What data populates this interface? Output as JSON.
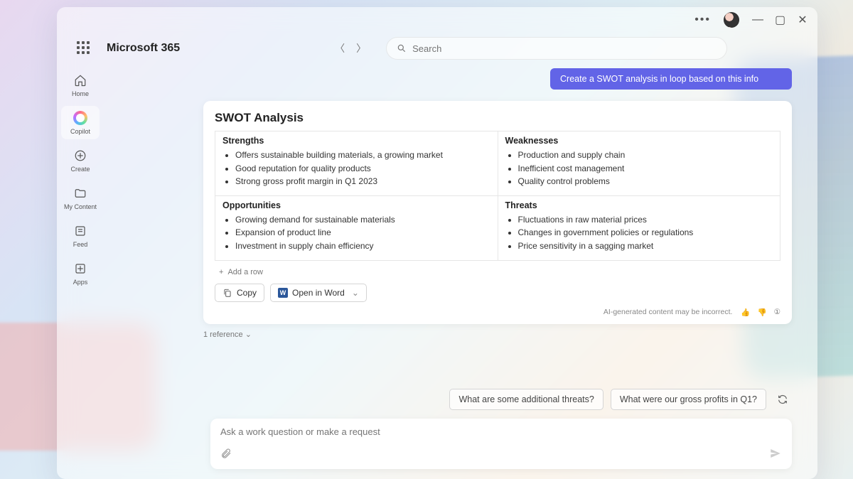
{
  "brand": "Microsoft 365",
  "search": {
    "placeholder": "Search"
  },
  "sidebar": {
    "items": [
      {
        "label": "Home"
      },
      {
        "label": "Copilot"
      },
      {
        "label": "Create"
      },
      {
        "label": "My Content"
      },
      {
        "label": "Feed"
      },
      {
        "label": "Apps"
      }
    ]
  },
  "chat": {
    "user_message": "Create a SWOT analysis in loop based on this info"
  },
  "swot": {
    "title": "SWOT Analysis",
    "cells": {
      "strengths": {
        "header": "Strengths",
        "items": [
          "Offers sustainable building materials, a growing market",
          "Good reputation for quality products",
          "Strong gross profit margin in Q1 2023"
        ]
      },
      "weaknesses": {
        "header": "Weaknesses",
        "items": [
          "Production and supply chain",
          "Inefficient cost management",
          "Quality control problems"
        ]
      },
      "opportunities": {
        "header": "Opportunities",
        "items": [
          "Growing demand for sustainable materials",
          "Expansion of product line",
          "Investment in supply chain efficiency"
        ]
      },
      "threats": {
        "header": "Threats",
        "items": [
          "Fluctuations in raw material prices",
          "Changes in government policies or regulations",
          "Price sensitivity in a sagging market"
        ]
      }
    },
    "add_row": "Add a row"
  },
  "actions": {
    "copy": "Copy",
    "open_word": "Open in Word"
  },
  "footer": {
    "disclaimer": "AI-generated content may be incorrect."
  },
  "references": {
    "label": "1 reference"
  },
  "suggestions": {
    "s1": "What are some additional threats?",
    "s2": "What were our gross profits in Q1?"
  },
  "compose": {
    "placeholder": "Ask a work question or make a request"
  }
}
